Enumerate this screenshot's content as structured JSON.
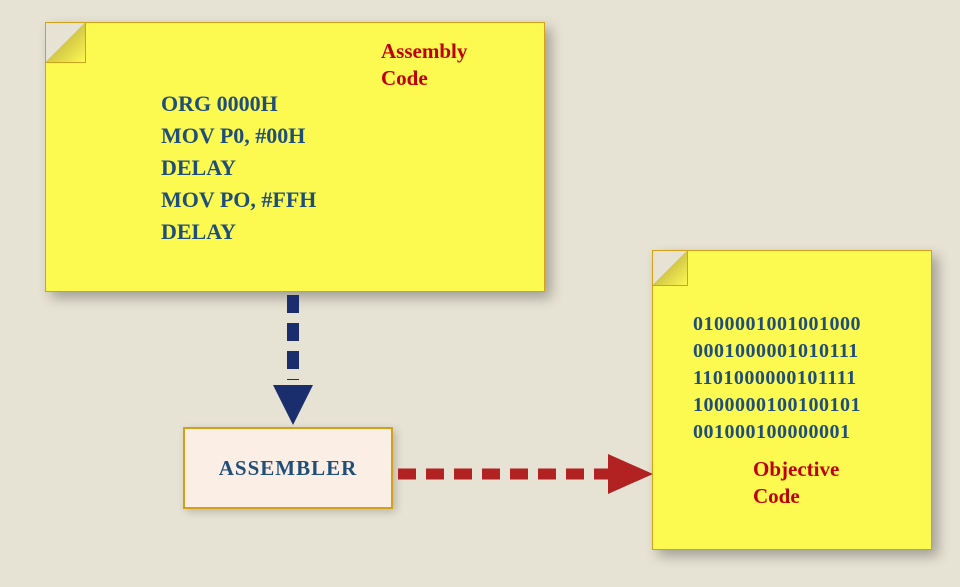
{
  "assembly": {
    "title": "Assembly\nCode",
    "code": "ORG 0000H\nMOV P0, #00H\nDELAY\nMOV PO, #FFH\nDELAY"
  },
  "assembler": {
    "label": "ASSEMBLER"
  },
  "objective": {
    "title": "Objective\nCode",
    "binary": "0100001001001000\n0001000001010111\n1101000000101111\n1000000100100101\n001000100000001"
  }
}
